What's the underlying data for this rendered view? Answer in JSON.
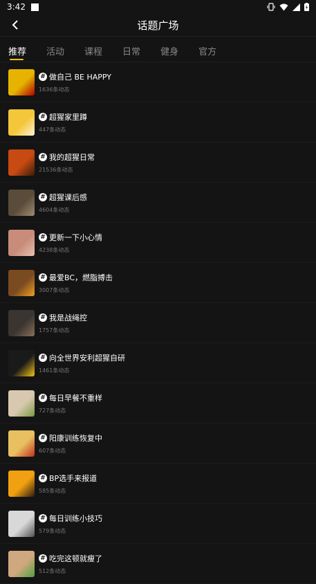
{
  "status": {
    "time": "3:42"
  },
  "header": {
    "title": "话题广场"
  },
  "tabs": [
    {
      "label": "推荐",
      "active": true
    },
    {
      "label": "活动",
      "active": false
    },
    {
      "label": "课程",
      "active": false
    },
    {
      "label": "日常",
      "active": false
    },
    {
      "label": "健身",
      "active": false
    },
    {
      "label": "官方",
      "active": false
    }
  ],
  "topics": [
    {
      "name": "做自己 BE HAPPY",
      "count": "1636条动态",
      "thumb": "#e6b400",
      "accent": "#b00000"
    },
    {
      "name": "超猩家里蹲",
      "count": "447条动态",
      "thumb": "#f4c63a",
      "accent": "#fff4d8"
    },
    {
      "name": "我的超猩日常",
      "count": "21536条动态",
      "thumb": "#c64a12",
      "accent": "#3a1c0a"
    },
    {
      "name": "超猩课后感",
      "count": "4604条动态",
      "thumb": "#5a4c3a",
      "accent": "#a08c72"
    },
    {
      "name": "更新一下小心情",
      "count": "4238条动态",
      "thumb": "#c98c7a",
      "accent": "#e8c0b0"
    },
    {
      "name": "最爱BC，燃脂搏击",
      "count": "3007条动态",
      "thumb": "#7a4a20",
      "accent": "#f0a020"
    },
    {
      "name": "我是战绳控",
      "count": "1757条动态",
      "thumb": "#3a3530",
      "accent": "#8a7058"
    },
    {
      "name": "向全世界安利超猩自研",
      "count": "1461条动态",
      "thumb": "#1a1a1a",
      "accent": "#f5c518"
    },
    {
      "name": "每日早餐不重样",
      "count": "727条动态",
      "thumb": "#d8c8b0",
      "accent": "#7a9a40"
    },
    {
      "name": "阳康训练恢复中",
      "count": "607条动态",
      "thumb": "#e8c060",
      "accent": "#c03020"
    },
    {
      "name": "BP选手来报道",
      "count": "585条动态",
      "thumb": "#f0a010",
      "accent": "#2a1a10"
    },
    {
      "name": "每日训练小技巧",
      "count": "579条动态",
      "thumb": "#d8d8d8",
      "accent": "#505050"
    },
    {
      "name": "吃完这顿就瘦了",
      "count": "512条动态",
      "thumb": "#d0a880",
      "accent": "#50a040"
    }
  ]
}
